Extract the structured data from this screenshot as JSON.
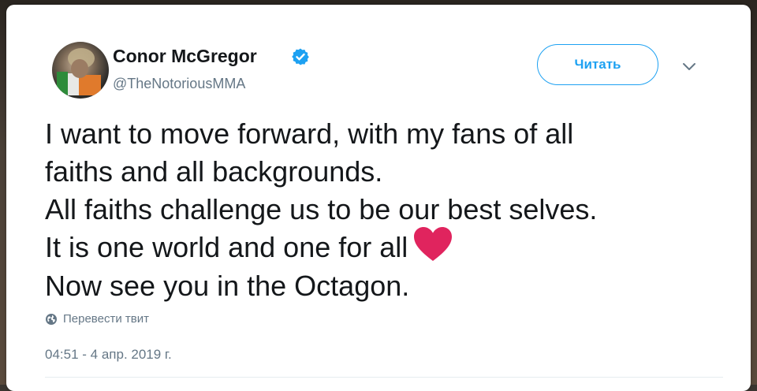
{
  "author": {
    "name": "Conor McGregor",
    "handle": "@TheNotoriousMMA",
    "verified": true,
    "avatar_icon": "profile-photo"
  },
  "header": {
    "follow_label": "Читать",
    "menu_icon": "chevron-down-icon"
  },
  "tweet": {
    "lines": [
      "I want to move forward, with my fans of all",
      "faiths and all backgrounds.",
      "All faiths challenge us to be our best selves.",
      "It is one world and one for all",
      "Now see you in the Octagon."
    ],
    "emoji": "heart-icon"
  },
  "footer": {
    "translate_label": "Перевести твит",
    "timestamp": "04:51 - 4 апр. 2019 г."
  },
  "colors": {
    "accent": "#1da1f2",
    "text": "#14171a",
    "secondary": "#657786",
    "heart": "#e0245e"
  }
}
